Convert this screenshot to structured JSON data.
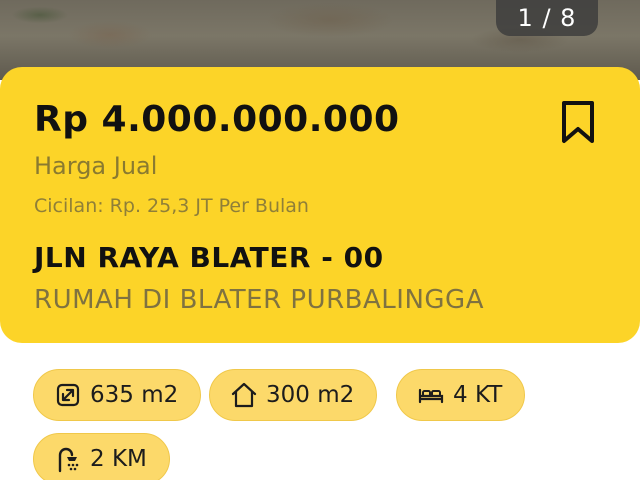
{
  "gallery": {
    "counter_text": "1 / 8"
  },
  "listing": {
    "price": "Rp 4.000.000.000",
    "price_label": "Harga Jual",
    "installment": "Cicilan: Rp. 25,3 JT Per Bulan",
    "street": "JLN RAYA BLATER - 00",
    "subtitle": "RUMAH DI BLATER PURBALINGGA",
    "bookmark_icon": "bookmark-outline-icon"
  },
  "features": [
    {
      "icon": "land-area-icon",
      "label": "635 m2"
    },
    {
      "icon": "building-area-icon",
      "label": "300 m2"
    },
    {
      "icon": "bedroom-icon",
      "label": "4 KT"
    },
    {
      "icon": "bathroom-icon",
      "label": "2 KM"
    }
  ],
  "colors": {
    "card_bg": "#fcd428",
    "chip_bg": "#fcd96a"
  }
}
